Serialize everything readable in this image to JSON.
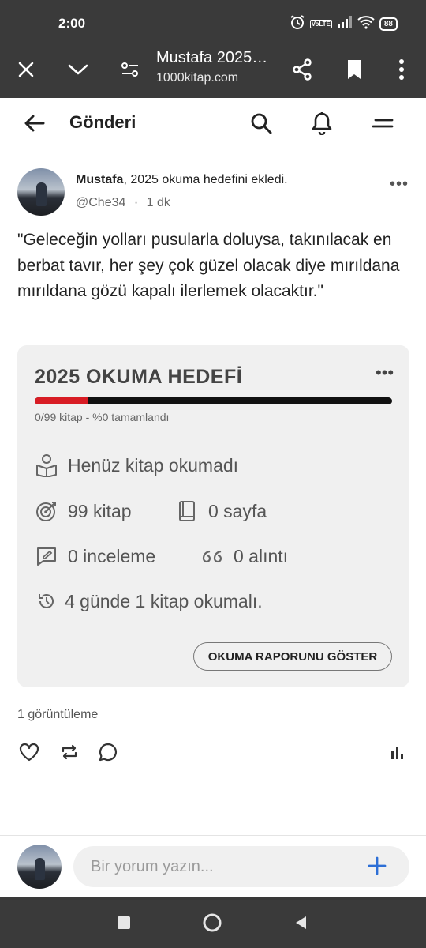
{
  "status_bar": {
    "time": "2:00",
    "network": "VoLTE",
    "battery": "88",
    "icons": [
      "alarm-icon",
      "volte-icon",
      "signal-icon",
      "wifi-icon",
      "battery-icon"
    ]
  },
  "browser": {
    "page_title": "Mustafa 2025…",
    "url": "1000kitap.com",
    "icons": [
      "close-icon",
      "chevron-down-icon",
      "page-settings-icon",
      "share-icon",
      "bookmark-icon",
      "more-vert-icon"
    ]
  },
  "header": {
    "title": "Gönderi",
    "icons": [
      "back-arrow-icon",
      "search-icon",
      "bell-icon",
      "menu-icon"
    ]
  },
  "post": {
    "author": "Mustafa",
    "action": ", 2025 okuma hedefini ekledi.",
    "handle": "@Che34",
    "separator": "·",
    "time": "1 dk",
    "more": "•••",
    "text": "\"Geleceğin yolları pusularla doluysa, takınılacak en berbat tavır, her şey çok güzel olacak diye mırıldana mırıldana  gözü kapalı ilerlemek olacaktır.\""
  },
  "goal_card": {
    "title": "2025 OKUMA HEDEFİ",
    "more": "•••",
    "progress_value": 0.15,
    "progress_text": "0/99 kitap - %0 tamamlandı",
    "status": "Henüz kitap okumadı",
    "books": "99 kitap",
    "pages": "0 sayfa",
    "reviews": "0 inceleme",
    "quotes": "0 alıntı",
    "pace": "4 günde 1 kitap okumalı.",
    "report_button": "OKUMA RAPORUNU GÖSTER",
    "colors": {
      "progress_fill": "#d81c24",
      "progress_track": "#111111"
    }
  },
  "views": "1 görüntüleme",
  "actions": [
    "heart-icon",
    "repost-icon",
    "comment-icon",
    "stats-icon"
  ],
  "comment": {
    "placeholder": "Bir yorum yazın...",
    "send_icon": "plus-icon",
    "accent": "#2d6fd6"
  },
  "nav": [
    "recents-icon",
    "home-icon",
    "back-icon"
  ]
}
